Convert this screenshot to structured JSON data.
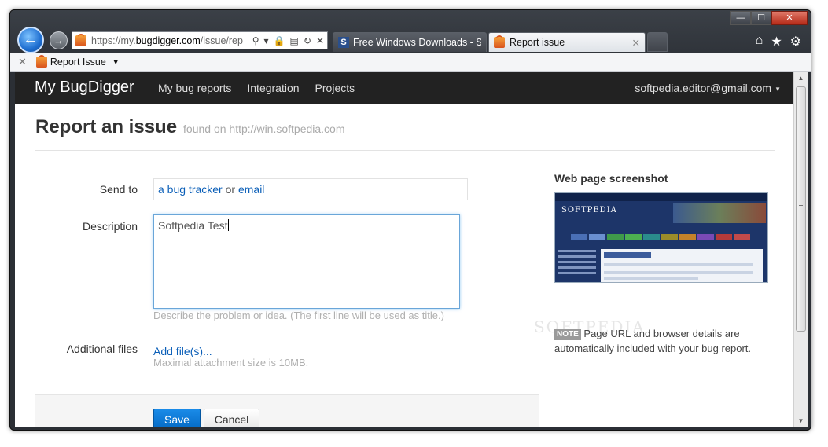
{
  "browser": {
    "address": {
      "prefix": "https://my.",
      "host": "bugdigger.com",
      "path": "/issue/rep"
    },
    "tabs": [
      {
        "label": "Free Windows Downloads - So..."
      },
      {
        "label": "Report issue",
        "close": "✕"
      }
    ],
    "favbar": {
      "close": "✕",
      "item_label": "Report Issue",
      "caret": "▼"
    },
    "window_controls": {
      "minimize": "—",
      "maximize": "☐",
      "close": "✕"
    },
    "nav": {
      "back": "←",
      "forward": "→"
    },
    "address_icons": {
      "search": "⚲",
      "dropdown": "▾",
      "lock": "🔒",
      "compat": "▤",
      "refresh": "↻",
      "stop": "✕"
    },
    "tools": {
      "home": "⌂",
      "favorites": "★",
      "settings": "⚙"
    }
  },
  "app": {
    "brand": "My BugDigger",
    "nav": [
      "My bug reports",
      "Integration",
      "Projects"
    ],
    "account": "softpedia.editor@gmail.com",
    "account_caret": "▼"
  },
  "page": {
    "title": "Report an issue",
    "subtitle": "found on http://win.softpedia.com"
  },
  "form": {
    "send_to": {
      "label": "Send to",
      "link1": "a bug tracker",
      "or": "or",
      "link2": "email"
    },
    "description": {
      "label": "Description",
      "value": "Softpedia Test",
      "help": "Describe the problem or idea. (The first line will be used as title.)"
    },
    "files": {
      "label": "Additional files",
      "link": "Add file(s)...",
      "help": "Maximal attachment size is 10MB."
    },
    "save": "Save",
    "cancel": "Cancel"
  },
  "sidebar": {
    "title": "Web page screenshot",
    "screenshot_logo": "SOFTPEDIA",
    "note_badge": "NOTE",
    "note_text": "Page URL and browser details are automatically included with your bug report."
  },
  "watermark": "SOFTPEDIA",
  "colors": {
    "topbar": "#222222",
    "link": "#0b5fb8",
    "primary_button": "#0469c4",
    "focus_border": "#6aa6d9"
  }
}
